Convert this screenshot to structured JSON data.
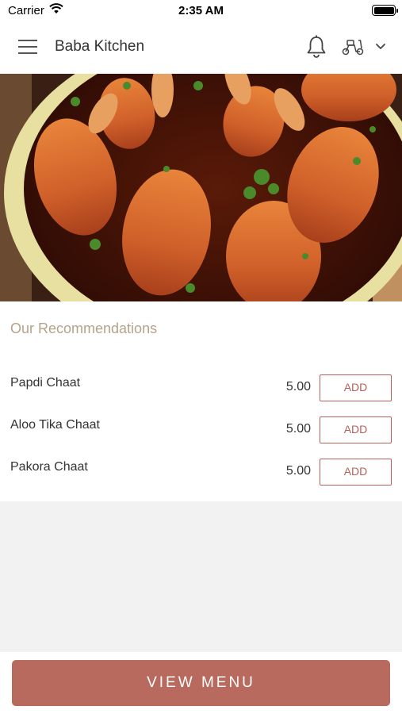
{
  "status_bar": {
    "carrier": "Carrier",
    "time": "2:35 AM"
  },
  "header": {
    "title": "Baba Kitchen",
    "icons": [
      "menu-icon",
      "bell-icon",
      "scooter-icon",
      "chevron-down-icon"
    ]
  },
  "hero": {
    "image": "food-image"
  },
  "recommendations": {
    "heading": "Our Recommendations",
    "items": [
      {
        "name": "Papdi Chaat",
        "price": "5.00",
        "add_label": "ADD"
      },
      {
        "name": "Aloo Tika Chaat",
        "price": "5.00",
        "add_label": "ADD"
      },
      {
        "name": "Pakora Chaat",
        "price": "5.00",
        "add_label": "ADD"
      }
    ]
  },
  "footer": {
    "view_menu_label": "VIEW MENU"
  },
  "colors": {
    "accent": "#b86a5e",
    "heading": "#b5a38a",
    "background": "#f2f2f2"
  }
}
